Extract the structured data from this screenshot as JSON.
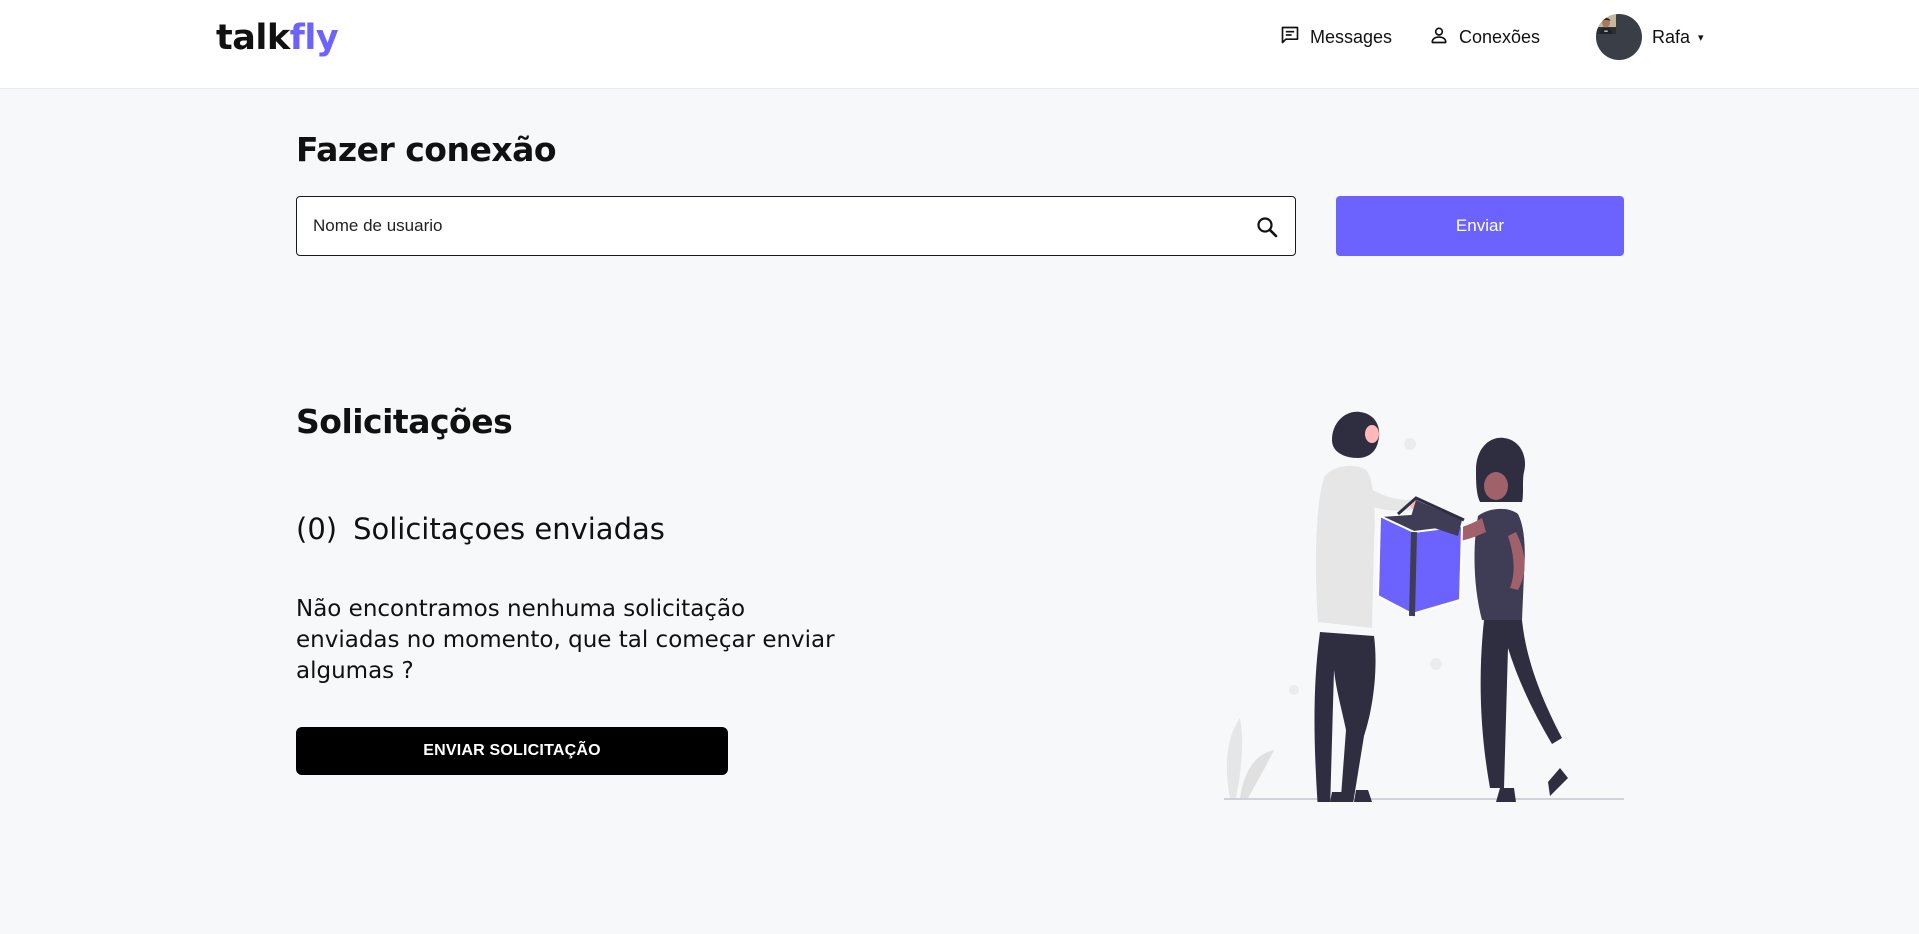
{
  "header": {
    "logo_part1": "talk",
    "logo_part2": "fly",
    "nav": [
      {
        "label": "Messages",
        "icon": "message-icon"
      },
      {
        "label": "Conexões",
        "icon": "user-icon"
      }
    ],
    "user": {
      "name": "Rafa",
      "caret": "▾"
    }
  },
  "connect": {
    "title": "Fazer conexão",
    "search_placeholder": "Nome de usuario",
    "search_value": "",
    "send_label": "Enviar"
  },
  "requests": {
    "title": "Solicitações",
    "count": "(0)",
    "count_label": "Solicitaçoes enviadas",
    "empty_message": "Não encontramos nenhuma solicitação enviadas no momento, que tal começar enviar algumas ?",
    "cta_label": "ENVIAR SOLICITAÇÃO"
  },
  "colors": {
    "accent": "#6c63ff",
    "header_bg": "#ffffff",
    "page_bg": "#f7f8fa",
    "cta_bg": "#000000"
  }
}
